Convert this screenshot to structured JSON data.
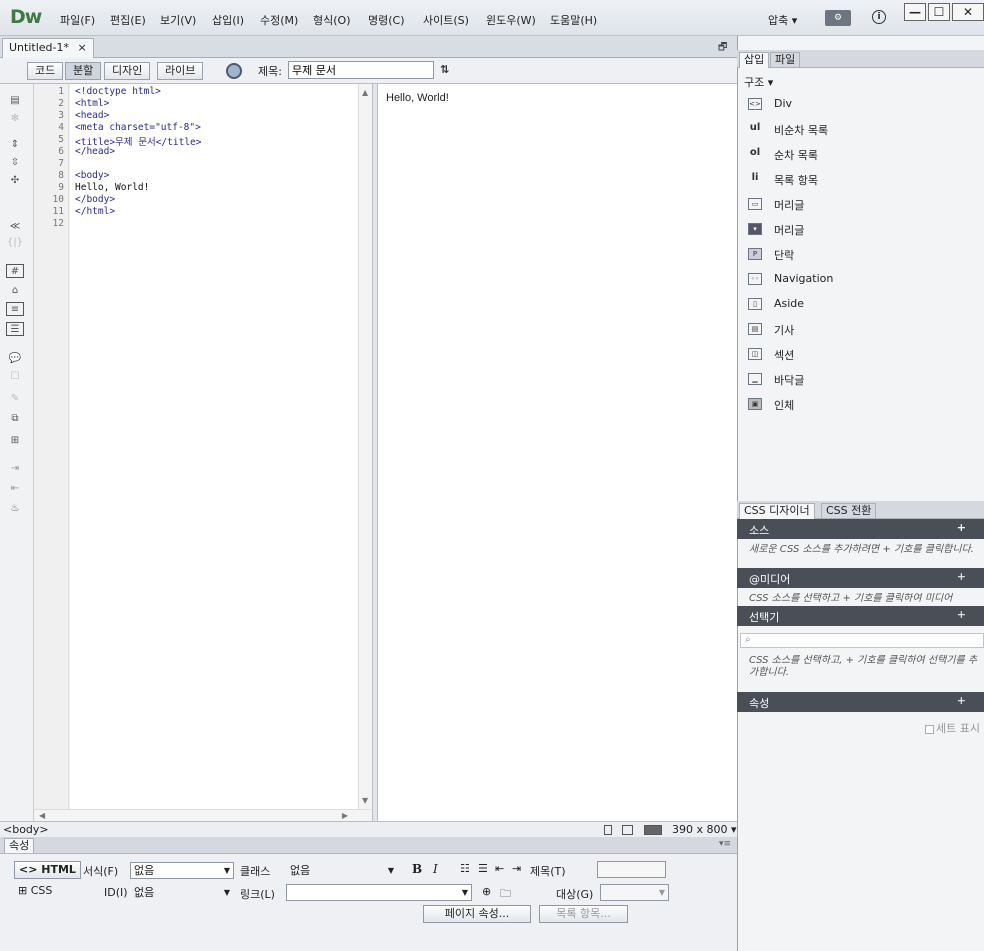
{
  "app": {
    "logo": "Dw"
  },
  "menu": [
    "파일(F)",
    "편집(E)",
    "보기(V)",
    "삽입(I)",
    "수정(M)",
    "형식(O)",
    "명령(C)",
    "사이트(S)",
    "윈도우(W)",
    "도움말(H)"
  ],
  "workspace": "압축 ▾",
  "window_buttons": {
    "minimize": "—",
    "maximize": "☐",
    "close": "✕"
  },
  "document": {
    "tab_label": "Untitled-1*",
    "tab_close": "×",
    "view_buttons": [
      "코드",
      "분할",
      "디자인",
      "라이브"
    ],
    "title_label": "제목:",
    "title_value": "무제 문서"
  },
  "code": {
    "line_numbers": [
      "1",
      "2",
      "3",
      "4",
      "5",
      "6",
      "7",
      "8",
      "9",
      "10",
      "11",
      "12"
    ],
    "lines": [
      "<!doctype html>",
      "<html>",
      "<head>",
      "<meta charset=\"utf-8\">",
      "<title>무제 문서</title>",
      "</head>",
      "",
      "<body>",
      "Hello, World!",
      "</body>",
      "</html>",
      ""
    ]
  },
  "design": {
    "text": "Hello, World!"
  },
  "statusbar": {
    "tag": "<body>",
    "size": "390 x 800 ▾"
  },
  "properties": {
    "header": "속성",
    "html_btn": "<> HTML",
    "css_btn": "CSS",
    "format_label": "서식(F)",
    "format_value": "없음",
    "class_label": "클래스",
    "class_value": "없음",
    "id_label": "ID(I)",
    "id_value": "없음",
    "link_label": "링크(L)",
    "title_label": "제목(T)",
    "target_label": "대상(G)",
    "page_props_btn": "페이지 속성...",
    "list_item_btn": "목록 항목...",
    "bold": "B",
    "italic": "I"
  },
  "insert_panel": {
    "tabs": [
      "삽입",
      "파일"
    ],
    "category": "구조 ▾",
    "items": [
      {
        "icon": "<>",
        "label": "Div"
      },
      {
        "icon": "ul",
        "label": "비순차 목록"
      },
      {
        "icon": "ol",
        "label": "순차 목록"
      },
      {
        "icon": "li",
        "label": "목록 항목"
      },
      {
        "icon": "▭",
        "label": "머리글"
      },
      {
        "icon": "▾",
        "label": "머리글"
      },
      {
        "icon": "P",
        "label": "단락"
      },
      {
        "icon": "◦◦",
        "label": "Navigation"
      },
      {
        "icon": "▯",
        "label": "Aside"
      },
      {
        "icon": "▤",
        "label": "기사"
      },
      {
        "icon": "◫",
        "label": "섹션"
      },
      {
        "icon": "▁",
        "label": "바닥글"
      },
      {
        "icon": "▣",
        "label": "인체"
      }
    ]
  },
  "css_panel": {
    "tabs": [
      "CSS 디자이너",
      "CSS 전환"
    ],
    "sources_header": "소스",
    "sources_hint": "새로운 CSS 소스를 추가하려면 + 기호를 클릭합니다.",
    "media_header": "@미디어",
    "media_hint": "CSS 소스를 선택하고 + 기호를 클릭하여 미디어",
    "selectors_header": "선택기",
    "selectors_hint": "CSS 소스를 선택하고, + 기호를 클릭하여 선택기를 추가합니다.",
    "properties_header": "속성",
    "show_set": "세트 표시"
  }
}
